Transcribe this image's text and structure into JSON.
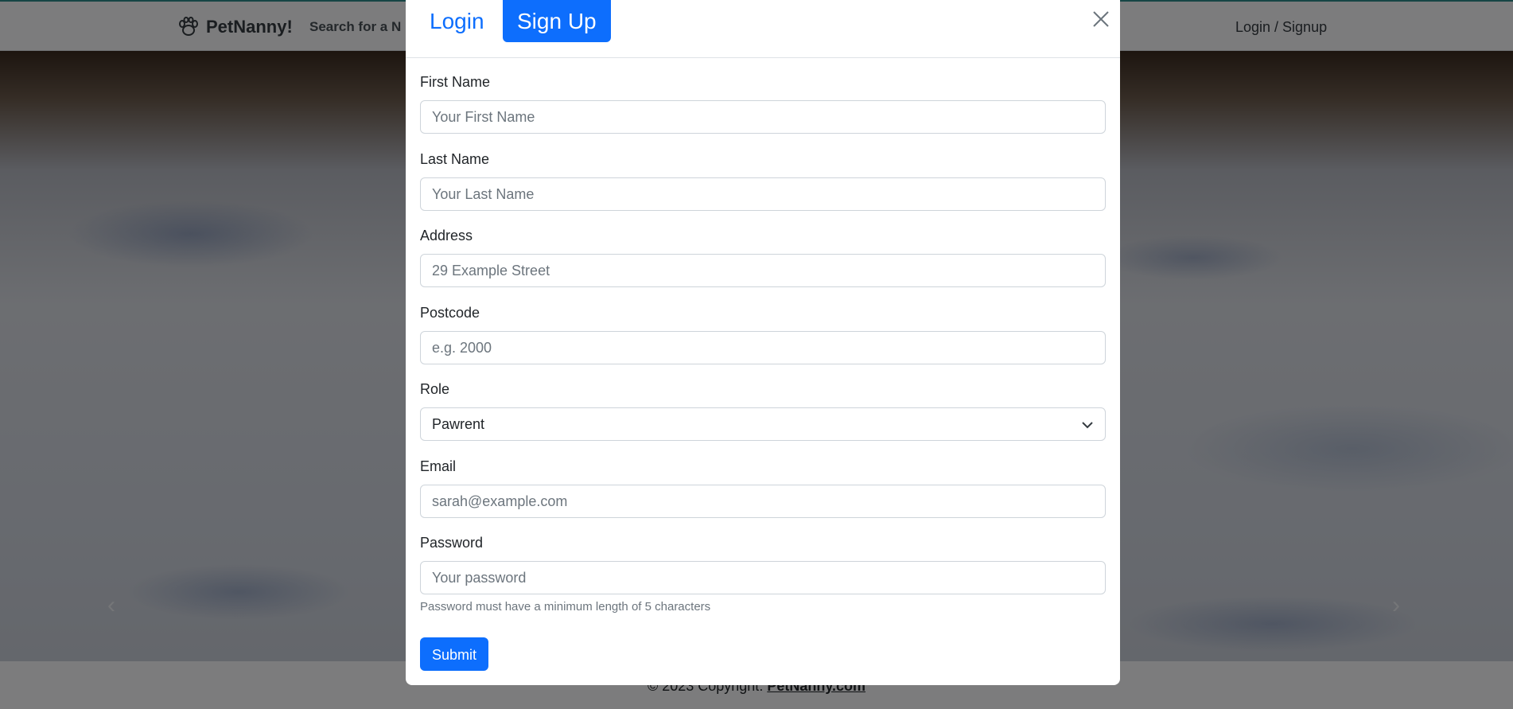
{
  "navbar": {
    "brand": "PetNanny!",
    "brand_icon": "paw-icon",
    "search_link": "Search for a N",
    "login_link": "Login / Signup"
  },
  "footer": {
    "copyright": "© 2023 Copyright: ",
    "site_link": "PetNanny.com"
  },
  "modal": {
    "tabs": {
      "login": "Login",
      "signup": "Sign Up",
      "active": "signup"
    },
    "close_icon": "close-icon",
    "fields": {
      "first_name": {
        "label": "First Name",
        "placeholder": "Your First Name"
      },
      "last_name": {
        "label": "Last Name",
        "placeholder": "Your Last Name"
      },
      "address": {
        "label": "Address",
        "placeholder": "29 Example Street"
      },
      "postcode": {
        "label": "Postcode",
        "placeholder": "e.g. 2000"
      },
      "role": {
        "label": "Role",
        "selected": "Pawrent"
      },
      "email": {
        "label": "Email",
        "placeholder": "sarah@example.com"
      },
      "password": {
        "label": "Password",
        "placeholder": "Your password",
        "help": "Password must have a minimum length of 5 characters"
      }
    },
    "submit": "Submit"
  },
  "colors": {
    "primary": "#0d6efd",
    "navbar_accent": "#2d8a8a"
  }
}
